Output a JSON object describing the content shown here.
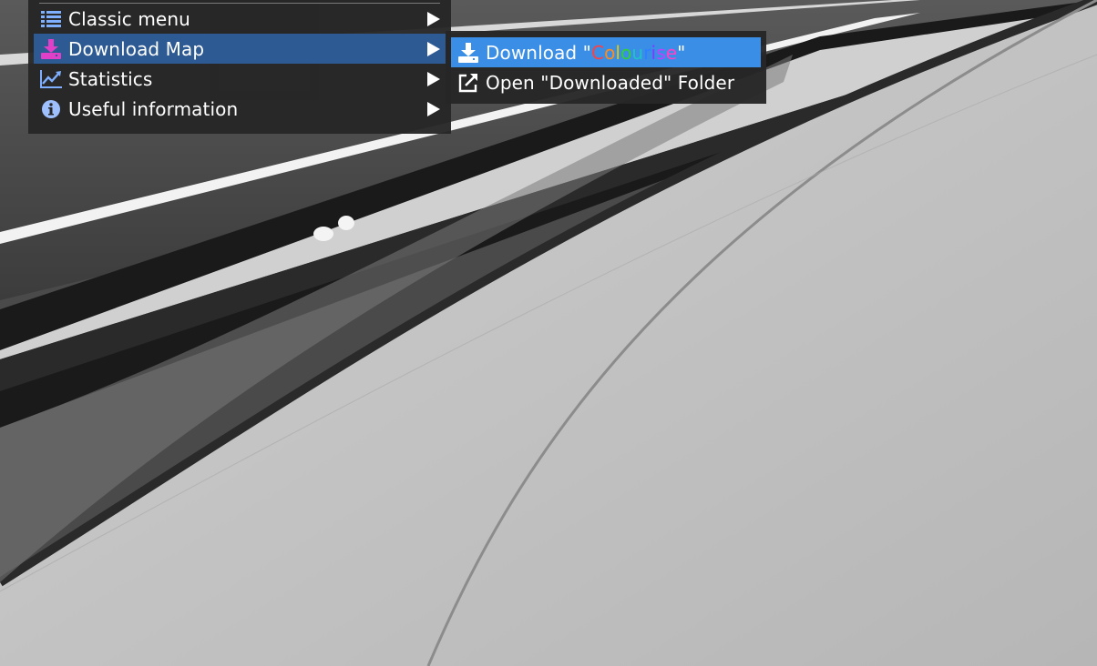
{
  "main_menu": {
    "items": [
      {
        "label": "Classic menu",
        "icon": "list-icon",
        "has_submenu": true
      },
      {
        "label": "Download Map",
        "icon": "download-icon",
        "has_submenu": true,
        "active": true
      },
      {
        "label": "Statistics",
        "icon": "line-chart-icon",
        "has_submenu": true
      },
      {
        "label": "Useful information",
        "icon": "info-circle-icon",
        "has_submenu": true
      }
    ]
  },
  "sub_menu": {
    "download": {
      "prefix": "Download \"",
      "name": "Colourise",
      "suffix": "\"",
      "name_colors": [
        "#ff4040",
        "#ff8c1a",
        "#e6c800",
        "#34d134",
        "#20c4c4",
        "#2f80ff",
        "#7a3cff",
        "#c040ff",
        "#ff40c8"
      ]
    },
    "open_folder": {
      "label": "Open \"Downloaded\" Folder",
      "icon": "external-link-icon"
    }
  },
  "colors": {
    "menu_bg": "#262626",
    "active_bg": "#2e5a94",
    "hover_bg": "#3a8ee6",
    "download_icon": "#e040c8",
    "list_icon": "#7fb0ff",
    "chart_icon": "#7fb0ff",
    "info_icon": "#9ec0ff"
  }
}
